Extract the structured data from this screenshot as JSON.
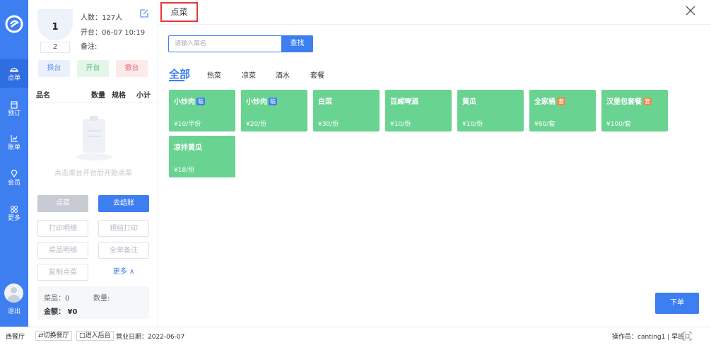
{
  "nav": {
    "items": [
      {
        "label": "点单",
        "icon": "dish-icon"
      },
      {
        "label": "预订",
        "icon": "calendar-icon"
      },
      {
        "label": "账单",
        "icon": "bill-chart-icon"
      },
      {
        "label": "会员",
        "icon": "member-diamond-icon"
      },
      {
        "label": "更多",
        "icon": "more-grid-icon"
      }
    ],
    "logout_label": "退出"
  },
  "order_panel": {
    "table_number": "1",
    "table_seats": "2",
    "guests": "人数：127人",
    "open_time": "开台：06-07 10:19",
    "remark": "备注:",
    "swap_label": "换台",
    "open_label": "开台",
    "cancel_label": "撤台",
    "columns": {
      "name": "品名",
      "qty": "数量",
      "spec": "规格",
      "subtotal": "小计"
    },
    "empty_tip": "点击桌台开台后开始点菜",
    "order_btn": "点菜",
    "checkout_btn": "去结账",
    "print_detail": "打印明细",
    "pre_print": "预结打印",
    "dish_detail": "菜品明细",
    "all_remark": "全单备注",
    "copy_dish": "复制点菜",
    "more_label": "更多 ∧",
    "summary": {
      "dishes": "菜品：0",
      "quantity": "数量:",
      "amount": "金额： ¥0"
    }
  },
  "main": {
    "title": "点菜",
    "search_placeholder": "请输入菜名",
    "search_label": "查找",
    "categories": [
      "全部",
      "热菜",
      "凉菜",
      "酒水",
      "套餐"
    ],
    "dishes": [
      {
        "name": "小炒肉",
        "tag": "临",
        "tag_color": "#3d7ef0",
        "price": "¥10/半份"
      },
      {
        "name": "小炒肉",
        "tag": "临",
        "tag_color": "#3d7ef0",
        "price": "¥20/份"
      },
      {
        "name": "白菜",
        "tag": "",
        "price": "¥30/份"
      },
      {
        "name": "百威啤酒",
        "tag": "",
        "price": "¥10/份"
      },
      {
        "name": "黄瓜",
        "tag": "",
        "price": "¥10/份"
      },
      {
        "name": "全家桶",
        "tag": "套",
        "tag_color": "#f08a4b",
        "price": "¥60/套"
      },
      {
        "name": "汉堡包套餐",
        "tag": "套",
        "tag_color": "#f08a4b",
        "price": "¥100/套"
      },
      {
        "name": "凉拌黄瓜",
        "tag": "",
        "price": "¥18/份"
      }
    ],
    "submit_label": "下单"
  },
  "statusbar": {
    "restaurant": "西餐厅",
    "switch_label": "⇄切换餐厅",
    "backend_label": "□进入后台",
    "business_date": "营业日期：2022-06-07",
    "operator": "操作员：canting1 | 早班"
  },
  "colors": {
    "accent": "#3d7ef0",
    "dish_bg": "#69d391",
    "highlight_border": "#e53935"
  }
}
